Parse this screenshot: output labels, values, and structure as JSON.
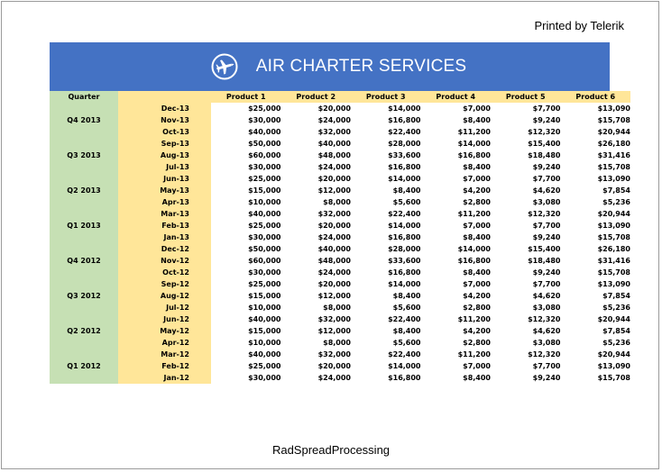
{
  "header": {
    "printed_by": "Printed by Telerik"
  },
  "banner": {
    "title": "AIR CHARTER SERVICES",
    "icon": "airplane-icon",
    "color": "#4472c4"
  },
  "table": {
    "headers": [
      "Quarter",
      "",
      "Product 1",
      "Product 2",
      "Product 3",
      "Product 4",
      "Product 5",
      "Product 6"
    ],
    "rows": [
      [
        "",
        "Dec-13",
        "$25,000",
        "$20,000",
        "$14,000",
        "$7,000",
        "$7,700",
        "$13,090"
      ],
      [
        "Q4 2013",
        "Nov-13",
        "$30,000",
        "$24,000",
        "$16,800",
        "$8,400",
        "$9,240",
        "$15,708"
      ],
      [
        "",
        "Oct-13",
        "$40,000",
        "$32,000",
        "$22,400",
        "$11,200",
        "$12,320",
        "$20,944"
      ],
      [
        "",
        "Sep-13",
        "$50,000",
        "$40,000",
        "$28,000",
        "$14,000",
        "$15,400",
        "$26,180"
      ],
      [
        "Q3 2013",
        "Aug-13",
        "$60,000",
        "$48,000",
        "$33,600",
        "$16,800",
        "$18,480",
        "$31,416"
      ],
      [
        "",
        "Jul-13",
        "$30,000",
        "$24,000",
        "$16,800",
        "$8,400",
        "$9,240",
        "$15,708"
      ],
      [
        "",
        "Jun-13",
        "$25,000",
        "$20,000",
        "$14,000",
        "$7,000",
        "$7,700",
        "$13,090"
      ],
      [
        "Q2 2013",
        "May-13",
        "$15,000",
        "$12,000",
        "$8,400",
        "$4,200",
        "$4,620",
        "$7,854"
      ],
      [
        "",
        "Apr-13",
        "$10,000",
        "$8,000",
        "$5,600",
        "$2,800",
        "$3,080",
        "$5,236"
      ],
      [
        "",
        "Mar-13",
        "$40,000",
        "$32,000",
        "$22,400",
        "$11,200",
        "$12,320",
        "$20,944"
      ],
      [
        "Q1 2013",
        "Feb-13",
        "$25,000",
        "$20,000",
        "$14,000",
        "$7,000",
        "$7,700",
        "$13,090"
      ],
      [
        "",
        "Jan-13",
        "$30,000",
        "$24,000",
        "$16,800",
        "$8,400",
        "$9,240",
        "$15,708"
      ],
      [
        "",
        "Dec-12",
        "$50,000",
        "$40,000",
        "$28,000",
        "$14,000",
        "$15,400",
        "$26,180"
      ],
      [
        "Q4 2012",
        "Nov-12",
        "$60,000",
        "$48,000",
        "$33,600",
        "$16,800",
        "$18,480",
        "$31,416"
      ],
      [
        "",
        "Oct-12",
        "$30,000",
        "$24,000",
        "$16,800",
        "$8,400",
        "$9,240",
        "$15,708"
      ],
      [
        "",
        "Sep-12",
        "$25,000",
        "$20,000",
        "$14,000",
        "$7,000",
        "$7,700",
        "$13,090"
      ],
      [
        "Q3 2012",
        "Aug-12",
        "$15,000",
        "$12,000",
        "$8,400",
        "$4,200",
        "$4,620",
        "$7,854"
      ],
      [
        "",
        "Jul-12",
        "$10,000",
        "$8,000",
        "$5,600",
        "$2,800",
        "$3,080",
        "$5,236"
      ],
      [
        "",
        "Jun-12",
        "$40,000",
        "$32,000",
        "$22,400",
        "$11,200",
        "$12,320",
        "$20,944"
      ],
      [
        "Q2 2012",
        "May-12",
        "$15,000",
        "$12,000",
        "$8,400",
        "$4,200",
        "$4,620",
        "$7,854"
      ],
      [
        "",
        "Apr-12",
        "$10,000",
        "$8,000",
        "$5,600",
        "$2,800",
        "$3,080",
        "$5,236"
      ],
      [
        "",
        "Mar-12",
        "$40,000",
        "$32,000",
        "$22,400",
        "$11,200",
        "$12,320",
        "$20,944"
      ],
      [
        "Q1 2012",
        "Feb-12",
        "$25,000",
        "$20,000",
        "$14,000",
        "$7,000",
        "$7,700",
        "$13,090"
      ],
      [
        "",
        "Jan-12",
        "$30,000",
        "$24,000",
        "$16,800",
        "$8,400",
        "$9,240",
        "$15,708"
      ]
    ]
  },
  "footer": {
    "text": "RadSpreadProcessing"
  }
}
